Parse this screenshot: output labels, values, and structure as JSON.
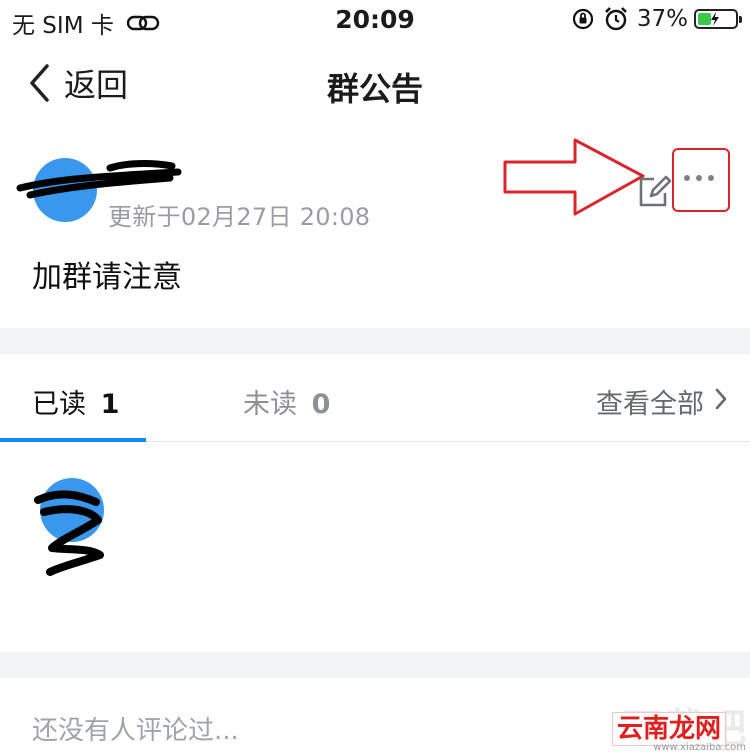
{
  "status_bar": {
    "carrier": "无 SIM 卡",
    "time": "20:09",
    "battery_percent": "37%",
    "battery_level": 0.37,
    "battery_color": "#3cc84a"
  },
  "nav": {
    "back_label": "返回",
    "title": "群公告"
  },
  "announcement": {
    "updated": "更新于02月27日 20:08",
    "content": "加群请注意"
  },
  "tabs": {
    "read_label": "已读",
    "read_count": "1",
    "unread_label": "未读",
    "unread_count": "0",
    "view_all": "查看全部"
  },
  "comments": {
    "empty_text": "还没有人评论过..."
  },
  "watermark": {
    "big": "下载吧",
    "box": "云南龙网",
    "url": "www.xiazaiba.com"
  },
  "colors": {
    "accent": "#1a8bf0",
    "avatar": "#3a97ee",
    "annotation_red": "#d9262b"
  },
  "icons": [
    "link-icon",
    "orientation-lock-icon",
    "alarm-icon",
    "battery-icon",
    "back-chevron-icon",
    "edit-icon",
    "more-icon",
    "chevron-right-icon",
    "arrow-annotation-icon"
  ]
}
